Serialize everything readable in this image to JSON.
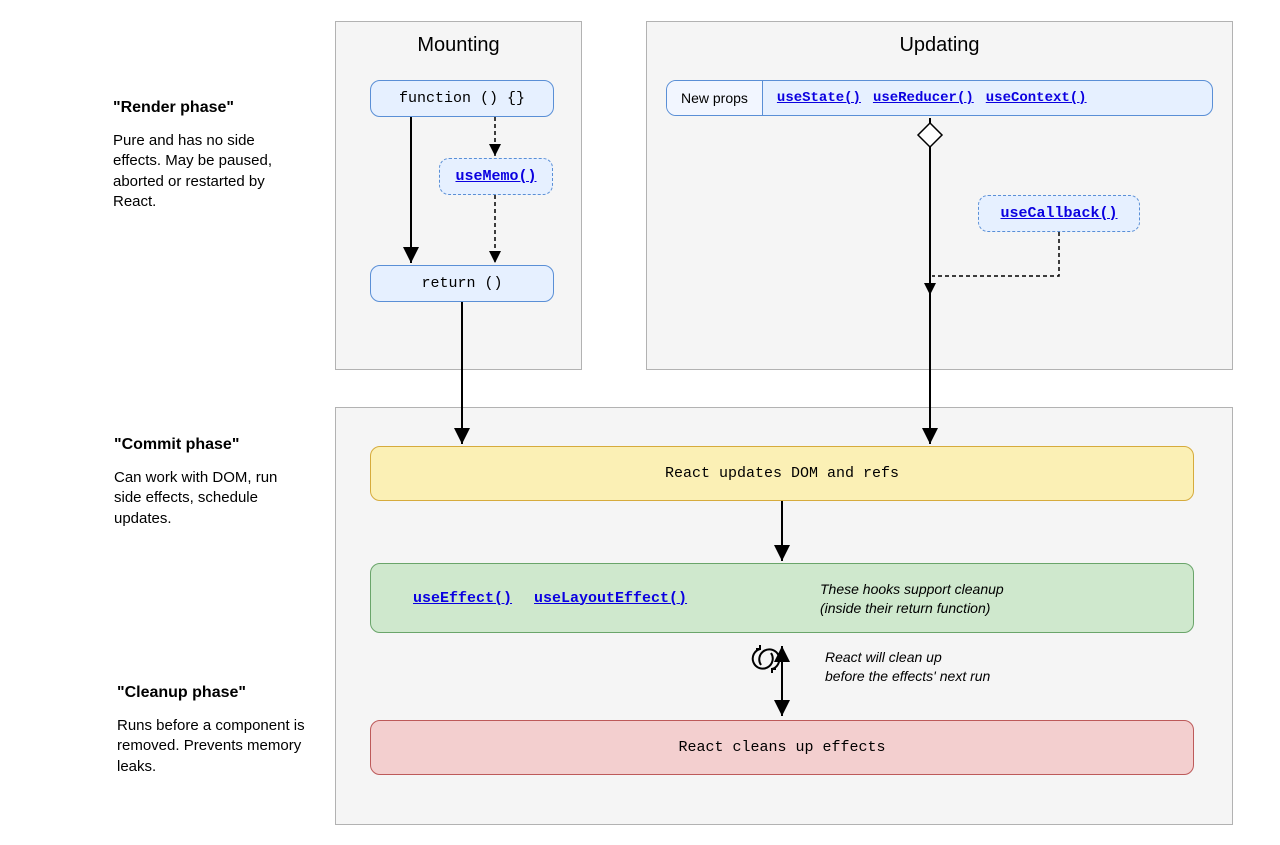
{
  "phases": {
    "render": {
      "title": "\"Render phase\"",
      "desc": "Pure and has no side effects. May be paused, aborted or restarted by React."
    },
    "commit": {
      "title": "\"Commit phase\"",
      "desc": "Can work with DOM, run side effects, schedule updates."
    },
    "cleanup": {
      "title": "\"Cleanup phase\"",
      "desc": "Runs before a component is removed. Prevents memory leaks."
    }
  },
  "panels": {
    "mounting": {
      "title": "Mounting"
    },
    "updating": {
      "title": "Updating"
    }
  },
  "nodes": {
    "func": "function () {}",
    "useMemo": "useMemo()",
    "ret": "return ()",
    "newProps": "New props",
    "useState": "useState()",
    "useReducer": "useReducer()",
    "useContext": "useContext()",
    "useCallback": "useCallback()",
    "domUpdate": "React updates DOM and refs",
    "useEffect": "useEffect()",
    "useLayoutEffect": "useLayoutEffect()",
    "cleanup": "React cleans up effects"
  },
  "notes": {
    "supportCleanup_l1": "These hooks support cleanup",
    "supportCleanup_l2": "(inside their return function)",
    "beforeNext_l1": "React will clean up",
    "beforeNext_l2": "before the effects' next run"
  }
}
